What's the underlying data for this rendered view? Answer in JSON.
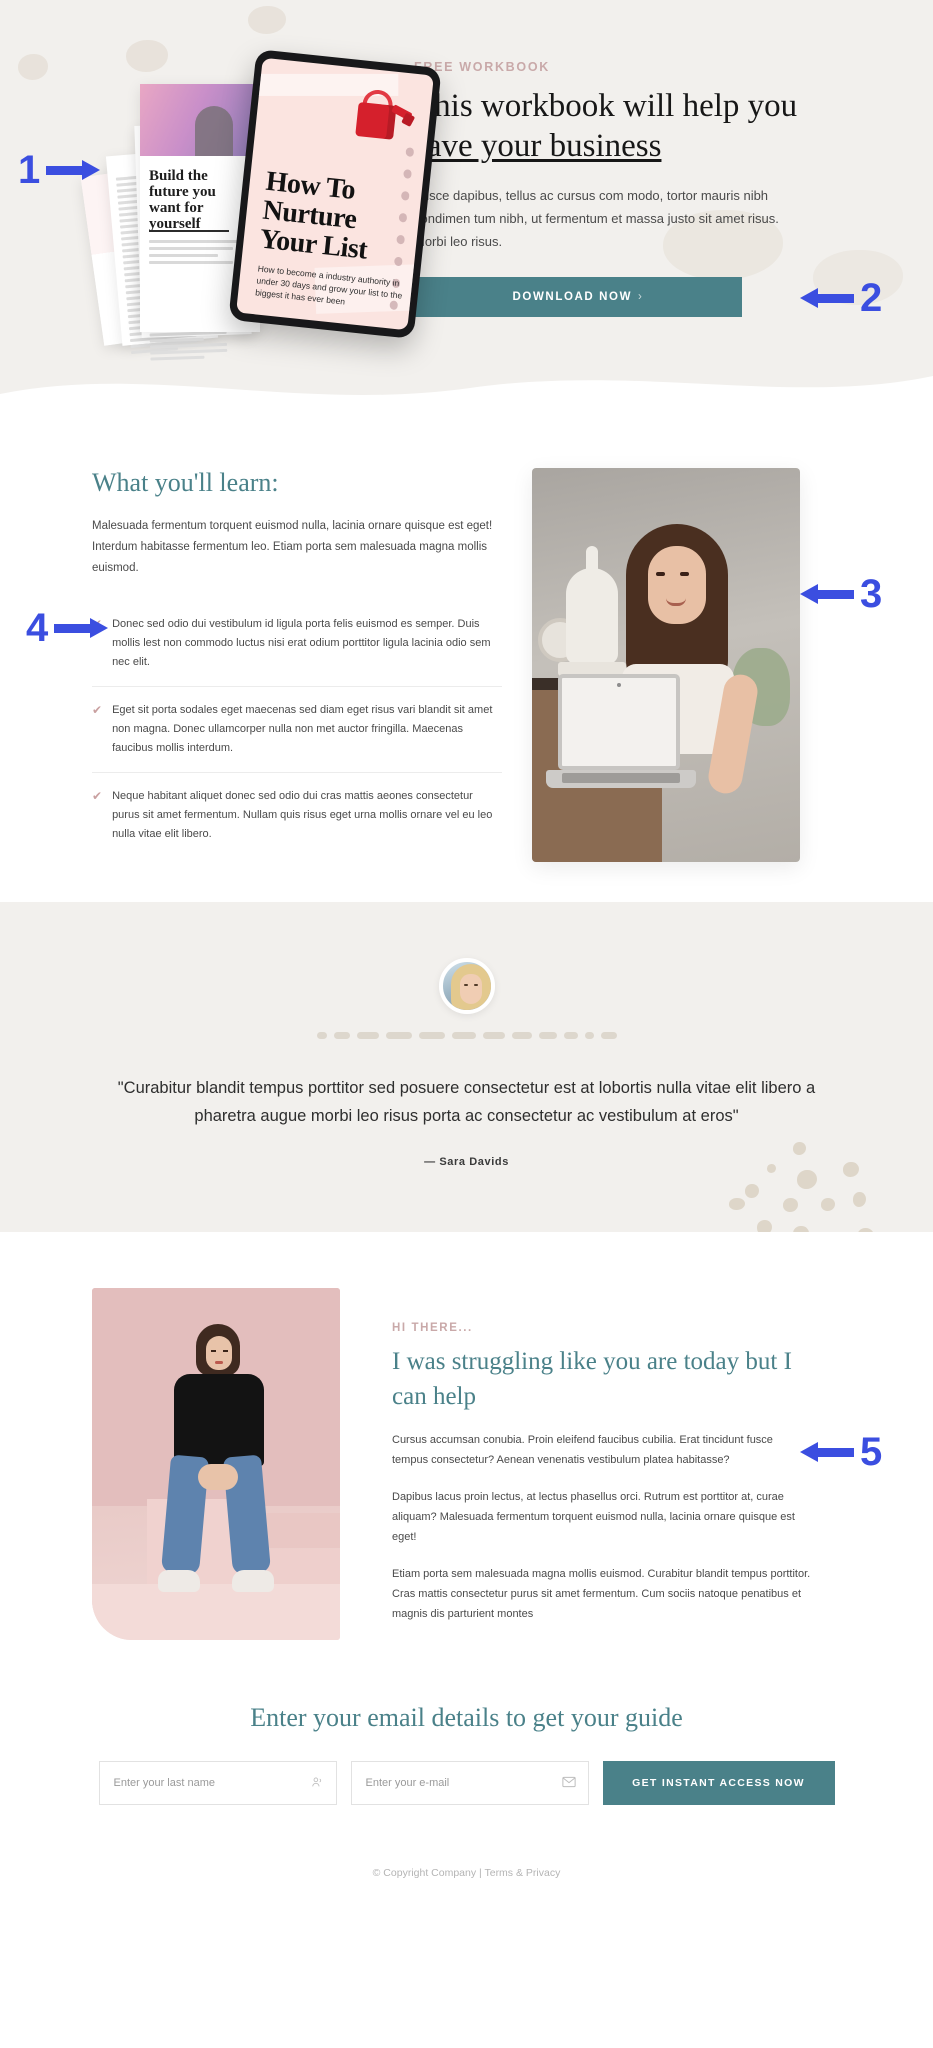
{
  "hero": {
    "eyebrow": "FREE WORKBOOK",
    "title_part1": "This workbook will help you ",
    "title_emphasis": "save your business",
    "body": "Fusce dapibus, tellus ac cursus com modo, tortor mauris nibh condimen tum nibh, ut fermentum et massa justo sit amet risus. Morbi leo risus.",
    "cta_label": "DOWNLOAD NOW",
    "cta_chevron": "›",
    "book": {
      "title": "How To Nurture Your List",
      "subtitle": "How to become a industry authority in under 30 days and grow your list to the biggest it has ever been",
      "sheet_headline": "Build the future you want for yourself"
    }
  },
  "learn": {
    "title": "What you'll learn:",
    "intro": "Malesuada fermentum torquent euismod nulla, lacinia ornare quisque est eget! Interdum habitasse fermentum leo. Etiam porta sem malesuada magna mollis euismod.",
    "items": [
      {
        "icon": "check-icon",
        "text": "Donec sed odio dui vestibulum id ligula porta felis euismod es semper. Duis mollis lest non commodo luctus nisi erat odium porttitor ligula lacinia odio sem nec elit."
      },
      {
        "icon": "check-icon",
        "text": "Eget sit porta sodales eget maecenas sed diam eget risus vari blandit sit amet non magna. Donec ullamcorper nulla non met auctor fringilla. Maecenas faucibus mollis interdum."
      },
      {
        "icon": "check-icon",
        "text": "Neque habitant aliquet donec sed odio dui cras mattis aeones consectetur purus sit amet fermentum. Nullam quis risus eget urna mollis ornare vel eu leo nulla vitae elit libero."
      }
    ]
  },
  "testimonial": {
    "quote": "\"Curabitur blandit tempus porttitor sed posuere consectetur est at lobortis nulla vitae elit libero a pharetra augue morbi leo risus porta ac consectetur ac vestibulum at eros\"",
    "author": "— Sara Davids"
  },
  "story": {
    "eyebrow": "HI THERE...",
    "title": "I was struggling like you are today but I can help",
    "paragraphs": [
      "Cursus accumsan conubia. Proin eleifend faucibus cubilia. Erat tincidunt fusce tempus consectetur? Aenean venenatis vestibulum platea habitasse?",
      "Dapibus lacus proin lectus, at lectus phasellus orci. Rutrum est porttitor at, curae aliquam? Malesuada fermentum torquent euismod nulla, lacinia ornare quisque est eget!",
      "Etiam porta sem malesuada magna mollis euismod. Curabitur blandit tempus porttitor. Cras mattis consectetur purus sit amet fermentum. Cum sociis natoque penatibus et magnis dis parturient montes"
    ]
  },
  "signup": {
    "title": "Enter your email details to get your guide",
    "name_placeholder": "Enter your last name",
    "name_value": "",
    "name_icon": "user-icon",
    "email_placeholder": "Enter your e-mail",
    "email_value": "",
    "email_icon": "envelope-icon",
    "submit_label": "GET INSTANT ACCESS NOW"
  },
  "footer": {
    "copyright": "© Copyright Company | Terms & Privacy"
  },
  "callouts": {
    "one": "1",
    "two": "2",
    "three": "3",
    "four": "4",
    "five": "5"
  },
  "colors": {
    "accent_teal": "#4a8189",
    "eyebrow_rose": "#c9a9a9",
    "callout_blue": "#3b4ee0",
    "hero_bg": "#f2f0ed",
    "check_rose": "#c9a0a0"
  }
}
